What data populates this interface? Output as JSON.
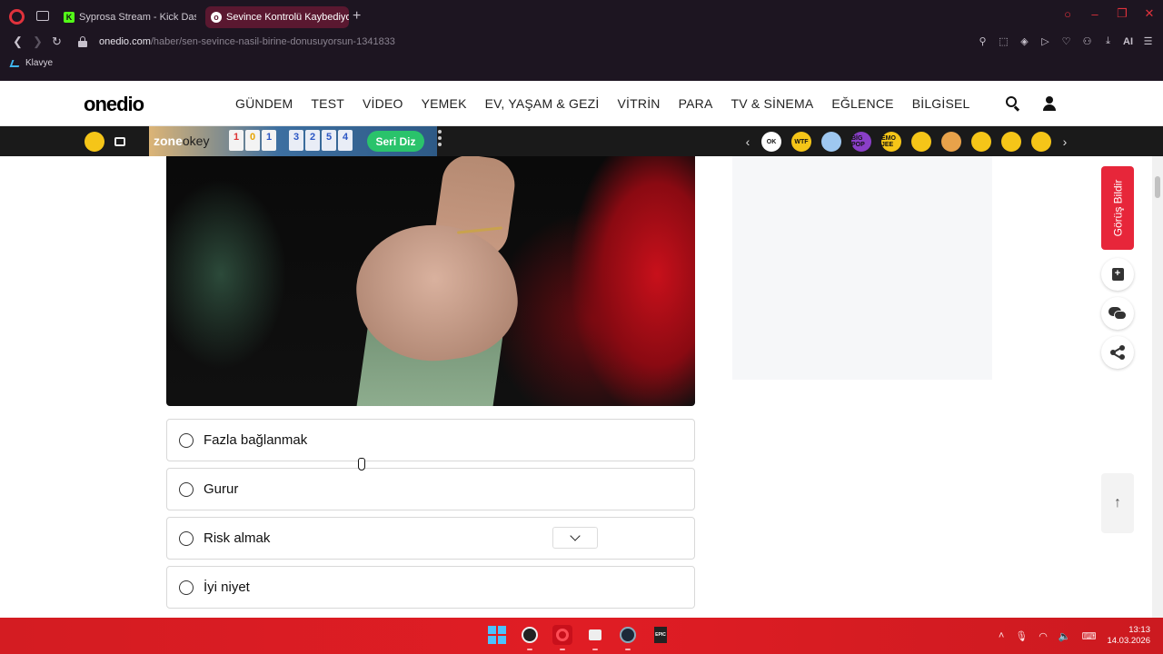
{
  "browser": {
    "tabs": [
      {
        "title": "Syprosa Stream - Kick Dash"
      },
      {
        "title": "Sevince Kontrolü Kaybediyorsun"
      }
    ],
    "url_host": "onedio.com",
    "url_path": "/haber/sen-sevince-nasil-birine-donusuyorsun-1341833",
    "toolbar_ai": "AI",
    "bookmark": "Klavye"
  },
  "site": {
    "logo": "onedio",
    "nav": [
      "GÜNDEM",
      "TEST",
      "VİDEO",
      "YEMEK",
      "EV, YAŞAM & GEZİ",
      "VİTRİN",
      "PARA",
      "TV & SİNEMA",
      "EĞLENCE",
      "BİLGİSEL"
    ]
  },
  "games_bar": {
    "zone": "zone",
    "okey": "okey",
    "tiles": [
      "1",
      "0",
      "1"
    ],
    "num_tiles": [
      "3",
      "2",
      "5",
      "4"
    ],
    "cta": "Seri Diz",
    "emojis": [
      {
        "label": "OK",
        "color": "#ffffff"
      },
      {
        "label": "WTF",
        "color": "#f5c518"
      },
      {
        "label": "",
        "color": "#9ec7f0"
      },
      {
        "label": "BİG POP",
        "color": "#8a3fc8"
      },
      {
        "label": "EMO JEE",
        "color": "#f5c518"
      },
      {
        "label": "",
        "color": "#f5c518"
      },
      {
        "label": "",
        "color": "#e8a24a"
      },
      {
        "label": "",
        "color": "#f5c518"
      },
      {
        "label": "",
        "color": "#f5c518"
      },
      {
        "label": "",
        "color": "#f5c518"
      }
    ]
  },
  "quiz": {
    "options": [
      "Fazla bağlanmak",
      "Gurur",
      "Risk almak",
      "İyi niyet"
    ]
  },
  "sidebar": {
    "feedback": "Görüş Bildir"
  },
  "taskbar": {
    "time": "13:13",
    "date": "14.03.2026"
  }
}
